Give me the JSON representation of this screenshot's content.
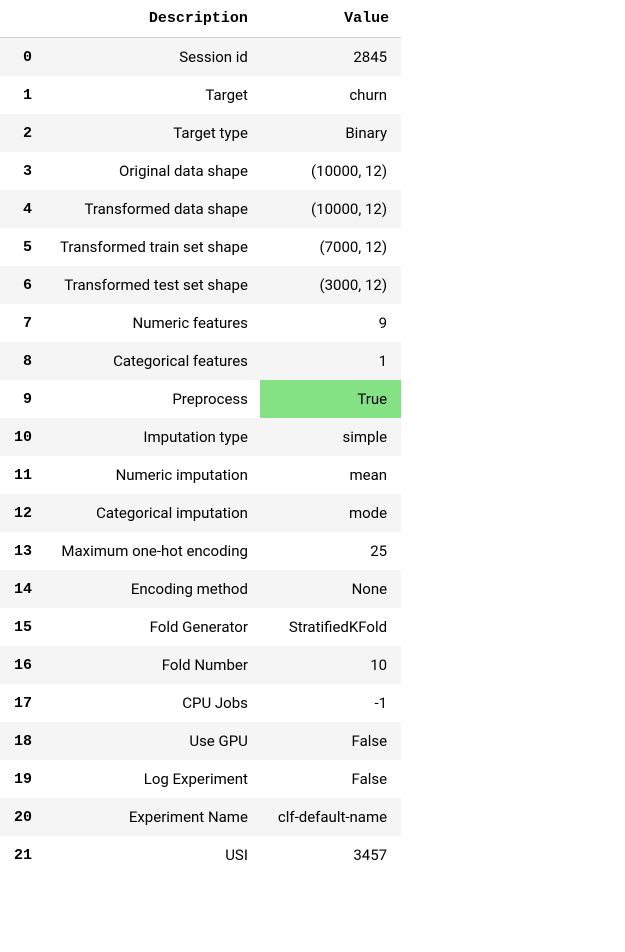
{
  "headers": {
    "index": "",
    "description": "Description",
    "value": "Value"
  },
  "rows": [
    {
      "index": "0",
      "description": "Session id",
      "value": "2845",
      "highlight": false
    },
    {
      "index": "1",
      "description": "Target",
      "value": "churn",
      "highlight": false
    },
    {
      "index": "2",
      "description": "Target type",
      "value": "Binary",
      "highlight": false
    },
    {
      "index": "3",
      "description": "Original data shape",
      "value": "(10000, 12)",
      "highlight": false
    },
    {
      "index": "4",
      "description": "Transformed data shape",
      "value": "(10000, 12)",
      "highlight": false
    },
    {
      "index": "5",
      "description": "Transformed train set shape",
      "value": "(7000, 12)",
      "highlight": false
    },
    {
      "index": "6",
      "description": "Transformed test set shape",
      "value": "(3000, 12)",
      "highlight": false
    },
    {
      "index": "7",
      "description": "Numeric features",
      "value": "9",
      "highlight": false
    },
    {
      "index": "8",
      "description": "Categorical features",
      "value": "1",
      "highlight": false
    },
    {
      "index": "9",
      "description": "Preprocess",
      "value": "True",
      "highlight": true
    },
    {
      "index": "10",
      "description": "Imputation type",
      "value": "simple",
      "highlight": false
    },
    {
      "index": "11",
      "description": "Numeric imputation",
      "value": "mean",
      "highlight": false
    },
    {
      "index": "12",
      "description": "Categorical imputation",
      "value": "mode",
      "highlight": false
    },
    {
      "index": "13",
      "description": "Maximum one-hot encoding",
      "value": "25",
      "highlight": false
    },
    {
      "index": "14",
      "description": "Encoding method",
      "value": "None",
      "highlight": false
    },
    {
      "index": "15",
      "description": "Fold Generator",
      "value": "StratifiedKFold",
      "highlight": false
    },
    {
      "index": "16",
      "description": "Fold Number",
      "value": "10",
      "highlight": false
    },
    {
      "index": "17",
      "description": "CPU Jobs",
      "value": "-1",
      "highlight": false
    },
    {
      "index": "18",
      "description": "Use GPU",
      "value": "False",
      "highlight": false
    },
    {
      "index": "19",
      "description": "Log Experiment",
      "value": "False",
      "highlight": false
    },
    {
      "index": "20",
      "description": "Experiment Name",
      "value": "clf-default-name",
      "highlight": false
    },
    {
      "index": "21",
      "description": "USI",
      "value": "3457",
      "highlight": false
    }
  ]
}
